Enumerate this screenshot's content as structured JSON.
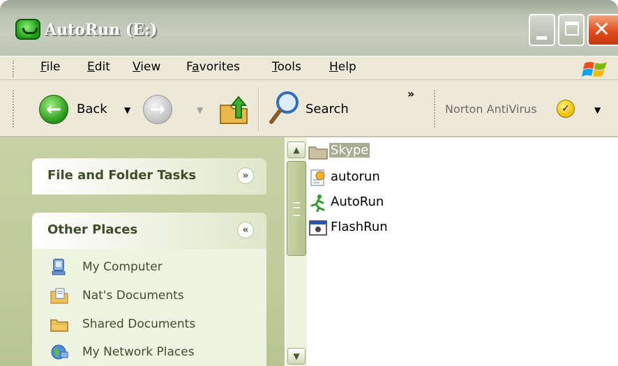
{
  "window": {
    "title": "AutoRun (E:)"
  },
  "menu": {
    "items": [
      {
        "label": "File",
        "accel": "F",
        "rest": "ile"
      },
      {
        "label": "Edit",
        "accel": "E",
        "rest": "dit"
      },
      {
        "label": "View",
        "accel": "V",
        "rest": "iew"
      },
      {
        "label": "Favorites",
        "pre": "F",
        "accel": "a",
        "rest": "vorites"
      },
      {
        "label": "Tools",
        "accel": "T",
        "rest": "ools"
      },
      {
        "label": "Help",
        "accel": "H",
        "rest": "elp"
      }
    ]
  },
  "toolbar": {
    "back_label": "Back",
    "search_label": "Search",
    "overflow": "»",
    "norton_label": "Norton AntiVirus"
  },
  "taskpane": {
    "file_tasks_title": "File and Folder Tasks",
    "file_tasks_chevron": "»",
    "other_places_title": "Other Places",
    "other_places_chevron": "«",
    "places": [
      {
        "label": "My Computer",
        "icon": "computer-icon"
      },
      {
        "label": "Nat's Documents",
        "icon": "documents-icon"
      },
      {
        "label": "Shared Documents",
        "icon": "folder-icon"
      },
      {
        "label": "My Network Places",
        "icon": "network-icon"
      }
    ]
  },
  "files": [
    {
      "name": "Skype",
      "icon": "folder-icon",
      "selected": true
    },
    {
      "name": "autorun",
      "icon": "setup-info-icon",
      "selected": false
    },
    {
      "name": "AutoRun",
      "icon": "running-man-icon",
      "selected": false
    },
    {
      "name": "FlashRun",
      "icon": "application-window-icon",
      "selected": false
    }
  ],
  "colors": {
    "taskpane_bg": "#c0cc9c",
    "panel_title": "#3f4d2a",
    "selection": "#a7ad92",
    "close_button": "#e04d1a"
  }
}
